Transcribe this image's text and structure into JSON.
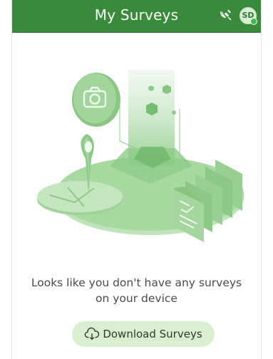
{
  "header": {
    "title": "My Surveys",
    "avatar_initials": "SD",
    "accent_color": "#3a8a3c"
  },
  "icons": {
    "gps": "satellite-signal-icon",
    "download": "cloud-download-icon"
  },
  "empty_state": {
    "message_line1": "Looks like you don't have any surveys",
    "message_line2": "on your device",
    "download_button_label": "Download Surveys"
  }
}
